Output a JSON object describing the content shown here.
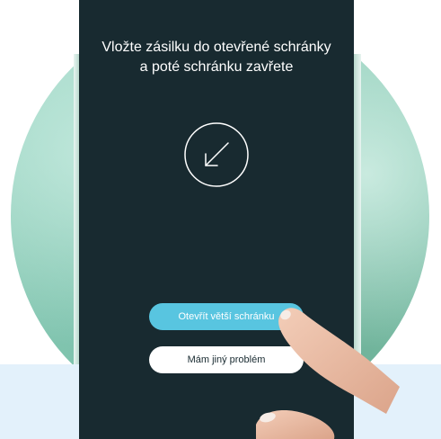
{
  "screen": {
    "instruction": "Vložte zásilku do otevřené schránky a poté schránku zavřete",
    "icon": "arrow-down-left-icon",
    "background_color": "#182a30"
  },
  "buttons": {
    "open_bigger_box": "Otevřít větší schránku",
    "other_problem": "Mám jiný problém"
  },
  "colors": {
    "primary_button": "#58c5e0",
    "secondary_button": "#ffffff"
  }
}
